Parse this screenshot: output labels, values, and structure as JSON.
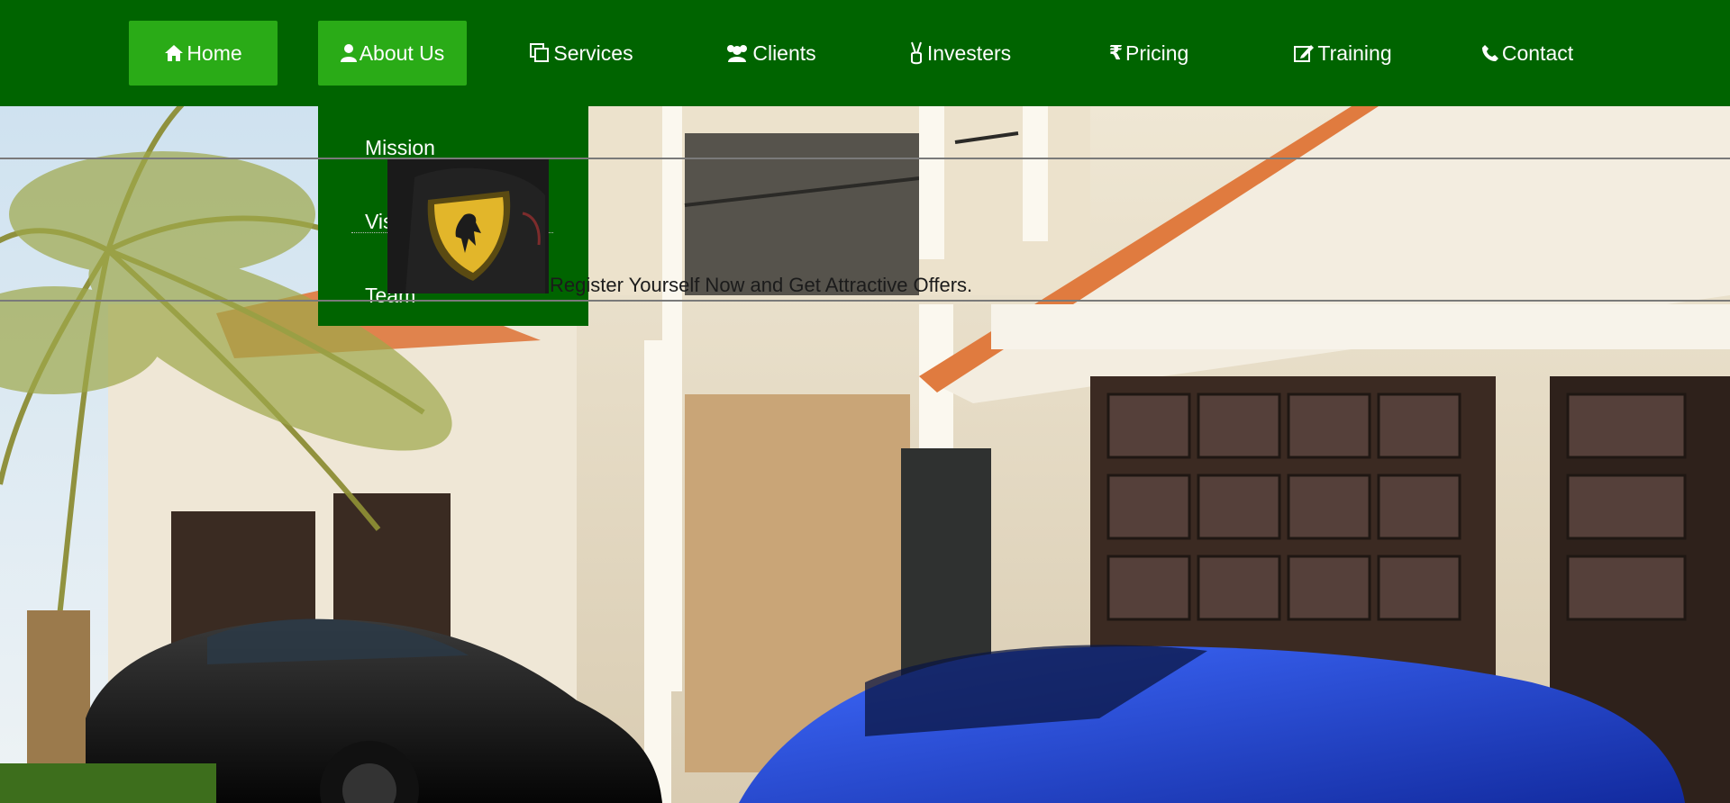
{
  "nav": {
    "items": [
      {
        "label": "Home",
        "icon": "home-icon"
      },
      {
        "label": "About Us",
        "icon": "user-icon"
      },
      {
        "label": "Services",
        "icon": "copy-icon"
      },
      {
        "label": "Clients",
        "icon": "users-icon"
      },
      {
        "label": "Investers",
        "icon": "victory-hand-icon"
      },
      {
        "label": "Pricing",
        "icon": "rupee-icon"
      },
      {
        "label": "Training",
        "icon": "edit-icon"
      },
      {
        "label": "Contact",
        "icon": "phone-icon"
      }
    ]
  },
  "dropdown": {
    "items": [
      {
        "label": "Mission"
      },
      {
        "label": "Vision"
      },
      {
        "label": "Team"
      }
    ]
  },
  "promo": {
    "text": "Register Yourself Now and Get Attractive Offers."
  },
  "colors": {
    "nav_bg": "#006400",
    "nav_active": "#2aab17",
    "text": "#ffffff"
  }
}
